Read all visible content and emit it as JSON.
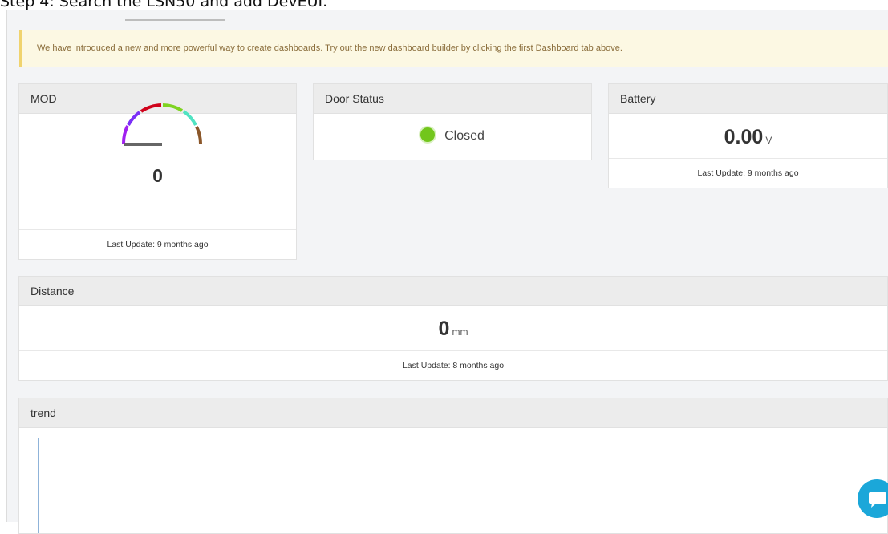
{
  "instruction": {
    "text": "Step 4: Search the LSN50 and add DevEUI."
  },
  "notice": {
    "text": "We have introduced a new and more powerful way to create dashboards. Try out the new dashboard builder by clicking the first Dashboard tab above."
  },
  "widgets": {
    "mod": {
      "title": "MOD",
      "value": "0",
      "last_update": "Last Update: 9 months ago",
      "gauge_colors": [
        "#a020f0",
        "#7b2ff7",
        "#d0021b",
        "#7ed321",
        "#50e3c2",
        "#8b572a"
      ],
      "gauge_needle_color": "#666666"
    },
    "door": {
      "title": "Door Status",
      "status": "Closed",
      "status_color": "#72c61c"
    },
    "battery": {
      "title": "Battery",
      "value": "0.00",
      "unit": "V",
      "last_update": "Last Update: 9 months ago"
    },
    "distance": {
      "title": "Distance",
      "value": "0",
      "unit": "mm",
      "last_update": "Last Update: 8 months ago"
    },
    "trend": {
      "title": "trend"
    }
  },
  "chat": {
    "icon": "chat-bubble-icon",
    "color": "#1ba7d9"
  }
}
